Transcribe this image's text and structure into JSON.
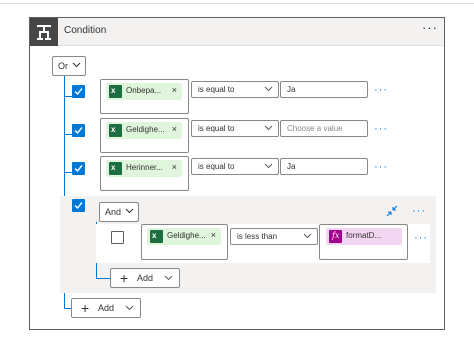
{
  "card": {
    "title": "Condition",
    "more_label": "···"
  },
  "or_group": {
    "operator": "Or"
  },
  "rows": [
    {
      "token": "Onbepa...",
      "operator": "is equal to",
      "value": "Ja",
      "placeholder": ""
    },
    {
      "token": "Geldighe...",
      "operator": "is equal to",
      "value": "",
      "placeholder": "Choose a value"
    },
    {
      "token": "Herinner...",
      "operator": "is equal to",
      "value": "Ja",
      "placeholder": ""
    }
  ],
  "and_group": {
    "operator": "And",
    "row": {
      "token": "Geldighe...",
      "operator": "is less than",
      "value_token": "formatD...",
      "value_token_icon": "fx"
    },
    "add_label": "Add"
  },
  "add_label": "Add",
  "token_close": "×",
  "token_icon_letter": "x",
  "row_more_label": "···",
  "colors": {
    "accent": "#0078d4",
    "excel": "#1d6f42",
    "excel_chip": "#dff6dd",
    "expr": "#a4008f",
    "expr_chip": "#f3d6f1"
  }
}
